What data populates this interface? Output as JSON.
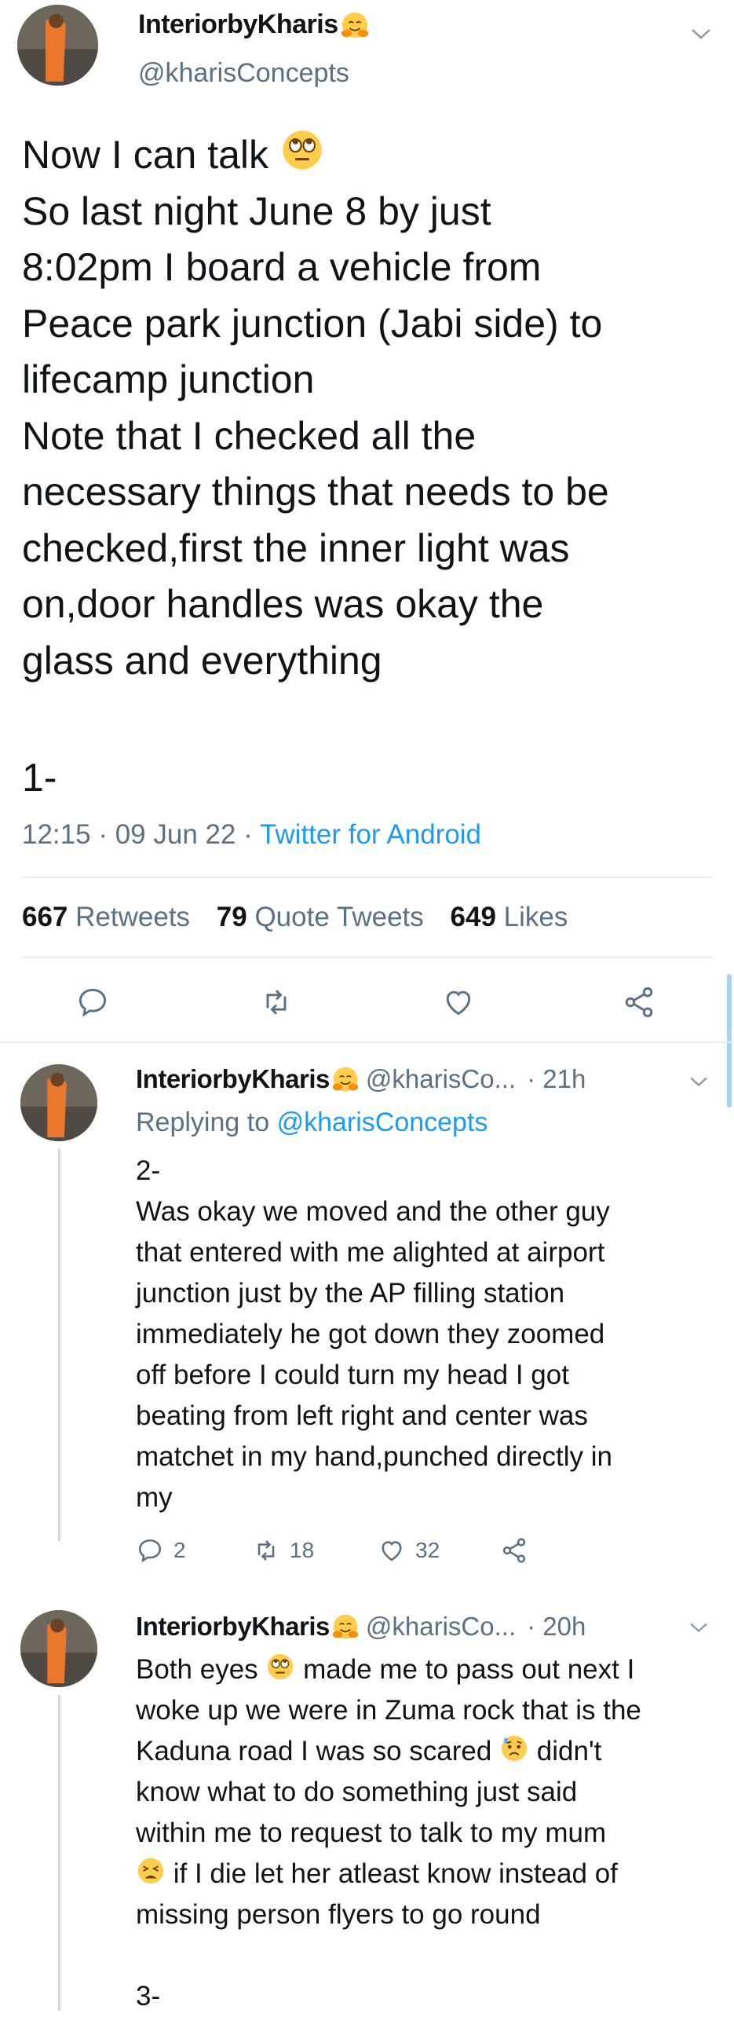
{
  "main": {
    "display_name": "InteriorbyKharis",
    "handle": "@kharisConcepts",
    "lines": [
      "Now I can talk",
      "So last night June 8 by just",
      "8:02pm I board a vehicle from",
      "Peace park junction (Jabi side) to",
      "lifecamp junction",
      "Note that I checked all the",
      "necessary things that needs to be",
      "checked,first the inner light was",
      "on,door handles was okay the",
      "glass and everything"
    ],
    "number": "1-",
    "time": "12:15",
    "date": "09 Jun 22",
    "source": "Twitter for Android",
    "retweets_count": "667",
    "retweets_label": "Retweets",
    "quotes_count": "79",
    "quotes_label": "Quote Tweets",
    "likes_count": "649",
    "likes_label": "Likes"
  },
  "reply1": {
    "display_name": "InteriorbyKharis",
    "handle": "@kharisCo...",
    "time": "· 21h",
    "replying_label": "Replying to",
    "replying_handle": "@kharisConcepts",
    "lines": [
      "2-",
      "Was okay we moved and the other guy",
      "that entered with me alighted at airport",
      "junction just by the AP filling station",
      "immediately he got down they zoomed",
      "off before I could turn my head I got",
      "beating from left right and center was",
      "matchet in my hand,punched directly in",
      "my"
    ],
    "reply_count": "2",
    "retweet_count": "18",
    "like_count": "32"
  },
  "reply2": {
    "display_name": "InteriorbyKharis",
    "handle": "@kharisCo...",
    "time": "· 20h",
    "line1a": "Both eyes",
    "line1b": "made me to pass out next I",
    "line2": "woke up we were in Zuma rock that is the",
    "line3a": "Kaduna road I was so scared",
    "line3b": "didn't",
    "line4": "know what to do something just said",
    "line5": "within me to request to talk to my mum",
    "line6": "if I die let her atleast know instead of",
    "line7": "missing person flyers to go round",
    "number": "3-"
  },
  "colors": {
    "accent": "#1d9bf0",
    "muted": "#5b7083",
    "divider": "#e6ecf0"
  },
  "icons": [
    "hugging-face-emoji",
    "rolling-eyes-emoji",
    "anxious-face-emoji",
    "tired-face-emoji",
    "chevron-down-icon",
    "reply-icon",
    "retweet-icon",
    "like-icon",
    "share-icon"
  ]
}
